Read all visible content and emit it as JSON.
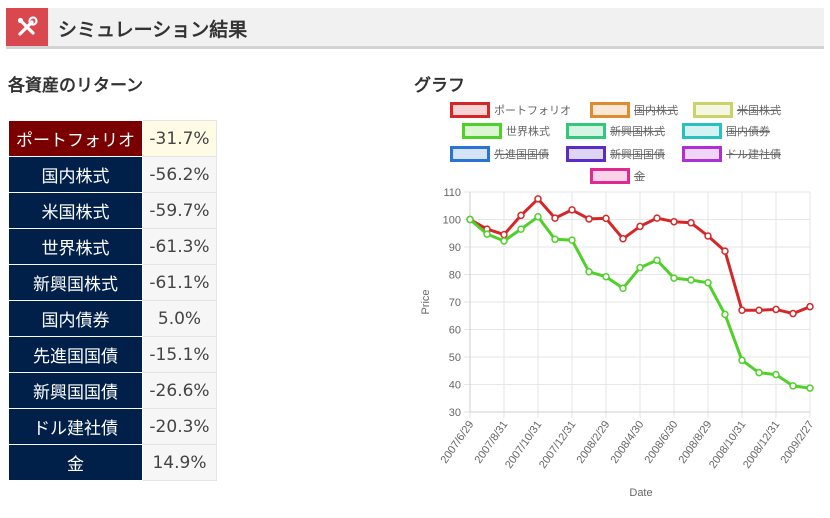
{
  "header": {
    "title": "シミュレーション結果",
    "icon": "tools-icon",
    "accent_color": "#d9484e"
  },
  "returns_section": {
    "title": "各資産のリターン",
    "rows": [
      {
        "name": "ポートフォリオ",
        "value": "-31.7%"
      },
      {
        "name": "国内株式",
        "value": "-56.2%"
      },
      {
        "name": "米国株式",
        "value": "-59.7%"
      },
      {
        "name": "世界株式",
        "value": "-61.3%"
      },
      {
        "name": "新興国株式",
        "value": "-61.1%"
      },
      {
        "name": "国内債券",
        "value": "5.0%"
      },
      {
        "name": "先進国国債",
        "value": "-15.1%"
      },
      {
        "name": "新興国国債",
        "value": "-26.6%"
      },
      {
        "name": "ドル建社債",
        "value": "-20.3%"
      },
      {
        "name": "金",
        "value": "14.9%"
      }
    ]
  },
  "chart_section": {
    "title": "グラフ"
  },
  "chart_data": {
    "type": "line",
    "xlabel": "Date",
    "ylabel": "Price",
    "ylim": [
      30,
      110
    ],
    "yticks": [
      30,
      40,
      50,
      60,
      70,
      80,
      90,
      100,
      110
    ],
    "grid": true,
    "legend_position": "top",
    "x": [
      "2007/6/29",
      "2007/7/31",
      "2007/8/31",
      "2007/9/28",
      "2007/10/31",
      "2007/11/30",
      "2007/12/31",
      "2008/1/31",
      "2008/2/29",
      "2008/3/31",
      "2008/4/30",
      "2008/5/30",
      "2008/6/30",
      "2008/7/31",
      "2008/8/29",
      "2008/9/30",
      "2008/10/31",
      "2008/11/28",
      "2008/12/31",
      "2009/1/30",
      "2009/2/27"
    ],
    "xtick_labels": [
      "2007/6/29",
      "2007/8/31",
      "2007/10/31",
      "2007/12/31",
      "2008/2/29",
      "2008/4/30",
      "2008/6/30",
      "2008/8/29",
      "2008/10/31",
      "2008/12/31",
      "2009/2/27"
    ],
    "series": [
      {
        "name": "ポートフォリオ",
        "color": "#d62728",
        "visible": true,
        "values": [
          100,
          96.5,
          94.5,
          101.5,
          107.5,
          100.5,
          103.5,
          100.2,
          100.4,
          93,
          97.5,
          100.5,
          99.2,
          98.8,
          94,
          88.5,
          67,
          67,
          67.3,
          65.8,
          68.3
        ]
      },
      {
        "name": "国内株式",
        "color": "#e08b30",
        "visible": false,
        "values": []
      },
      {
        "name": "米国株式",
        "color": "#c9d36a",
        "visible": false,
        "values": []
      },
      {
        "name": "世界株式",
        "color": "#4fd12a",
        "visible": true,
        "values": [
          100,
          94.7,
          92.2,
          96.5,
          101,
          92.8,
          92.5,
          81,
          79.2,
          75,
          82.5,
          85.2,
          78.7,
          78,
          77,
          65.5,
          48.8,
          44.3,
          43.6,
          39.5,
          38.7
        ]
      },
      {
        "name": "新興国株式",
        "color": "#33c77a",
        "visible": false,
        "values": []
      },
      {
        "name": "国内債券",
        "color": "#2bc0c0",
        "visible": false,
        "values": []
      },
      {
        "name": "先進国国債",
        "color": "#2a73d6",
        "visible": false,
        "values": []
      },
      {
        "name": "新興国国債",
        "color": "#5b2bc8",
        "visible": false,
        "values": []
      },
      {
        "name": "ドル建社債",
        "color": "#b02fd0",
        "visible": false,
        "values": []
      },
      {
        "name": "金",
        "color": "#e0288f",
        "visible": false,
        "values": []
      }
    ]
  }
}
